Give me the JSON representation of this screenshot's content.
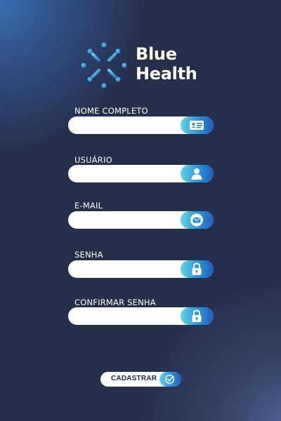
{
  "brand": {
    "name_line1": "Blue",
    "name_line2": "Health",
    "logo_icon": "asterisk-dots-logo"
  },
  "colors": {
    "accent_start": "#5fd6e4",
    "accent_end": "#1d5fb5",
    "background": "#252e4b",
    "field_bg": "#ffffff"
  },
  "form": {
    "fields": [
      {
        "label": "NOME COMPLETO",
        "value": "",
        "icon": "id-card-icon"
      },
      {
        "label": "USUÁRIO",
        "value": "",
        "icon": "user-icon"
      },
      {
        "label": "E-MAIL",
        "value": "",
        "icon": "envelope-icon"
      },
      {
        "label": "SENHA",
        "value": "",
        "icon": "lock-icon"
      },
      {
        "label": "CONFIRMAR SENHA",
        "value": "",
        "icon": "lock-icon"
      }
    ],
    "submit_label": "CADASTRAR",
    "submit_icon": "check-circle-icon"
  }
}
